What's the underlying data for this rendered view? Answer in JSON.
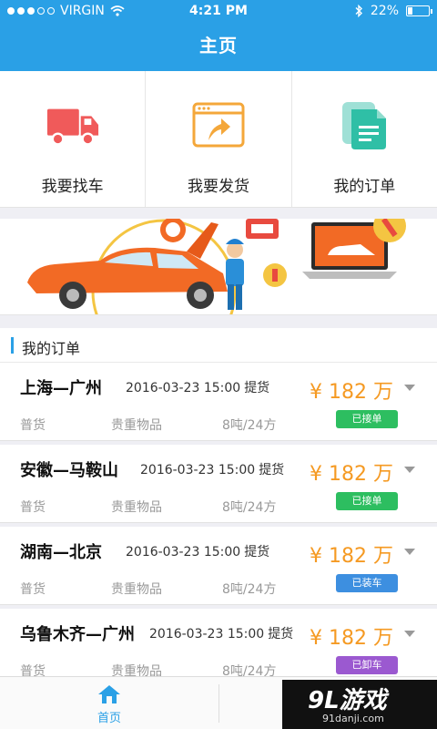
{
  "status_bar": {
    "carrier": "VIRGIN",
    "time": "4:21 PM",
    "battery": "22%",
    "battery_level": 0.22
  },
  "header": {
    "title": "主页"
  },
  "actions": [
    {
      "label": "我要找车",
      "icon": "truck-icon"
    },
    {
      "label": "我要发货",
      "icon": "ship-goods-icon"
    },
    {
      "label": "我的订单",
      "icon": "orders-doc-icon"
    }
  ],
  "banner": {
    "icon": "car-repair-illustration"
  },
  "orders_section": {
    "title": "我的订单"
  },
  "orders": [
    {
      "route": "上海—广州",
      "date": "2016-03-23",
      "time": "15:00",
      "pickup": "提货",
      "price": "¥ 182 万",
      "type": "普货",
      "goods": "贵重物品",
      "weight": "8吨/24方",
      "status": "已接单",
      "status_color": "#2dbe60"
    },
    {
      "route": "安徽—马鞍山",
      "date": "2016-03-23",
      "time": "15:00",
      "pickup": "提货",
      "price": "¥ 182 万",
      "type": "普货",
      "goods": "贵重物品",
      "weight": "8吨/24方",
      "status": "已接单",
      "status_color": "#2dbe60"
    },
    {
      "route": "湖南—北京",
      "date": "2016-03-23",
      "time": "15:00",
      "pickup": "提货",
      "price": "¥ 182 万",
      "type": "普货",
      "goods": "贵重物品",
      "weight": "8吨/24方",
      "status": "已装车",
      "status_color": "#3d8fe0"
    },
    {
      "route": "乌鲁木齐—广州",
      "date": "2016-03-23",
      "time": "15:00",
      "pickup": "提货",
      "price": "¥ 182 万",
      "type": "普货",
      "goods": "贵重物品",
      "weight": "8吨/24方",
      "status": "已卸车",
      "status_color": "#9b59d0"
    }
  ],
  "tabbar": {
    "home_label": "首页"
  },
  "watermark": {
    "brand": "9L游戏",
    "site": "91danji.com"
  },
  "colors": {
    "primary": "#2aa0e6",
    "price": "#f59a23"
  }
}
